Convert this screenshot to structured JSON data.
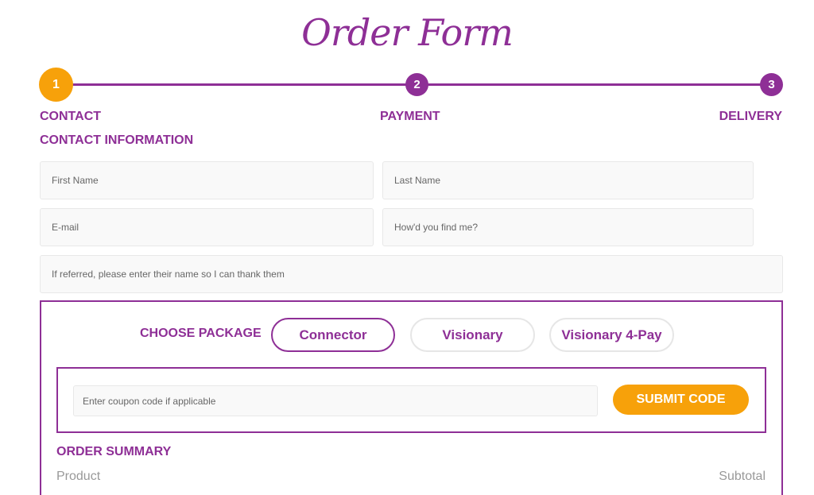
{
  "header": {
    "title": "Order Form"
  },
  "steps": [
    {
      "number": "1",
      "label": "CONTACT"
    },
    {
      "number": "2",
      "label": "PAYMENT"
    },
    {
      "number": "3",
      "label": "DELIVERY"
    }
  ],
  "contact": {
    "section_title": "CONTACT INFORMATION",
    "first_name_placeholder": "First Name",
    "last_name_placeholder": "Last Name",
    "email_placeholder": "E-mail",
    "find_placeholder": "How'd you find me?",
    "referral_placeholder": "If referred, please enter their name so I can thank them"
  },
  "package": {
    "label": "CHOOSE PACKAGE",
    "options": [
      "Connector",
      "Visionary",
      "Visionary 4-Pay"
    ],
    "selected": "Connector"
  },
  "coupon": {
    "placeholder": "Enter coupon code if applicable",
    "submit_label": "SUBMIT CODE"
  },
  "summary": {
    "title": "ORDER SUMMARY",
    "columns": [
      "Product",
      "Subtotal"
    ]
  },
  "colors": {
    "brand": "#8e2f96",
    "accent": "#f7a10a"
  }
}
